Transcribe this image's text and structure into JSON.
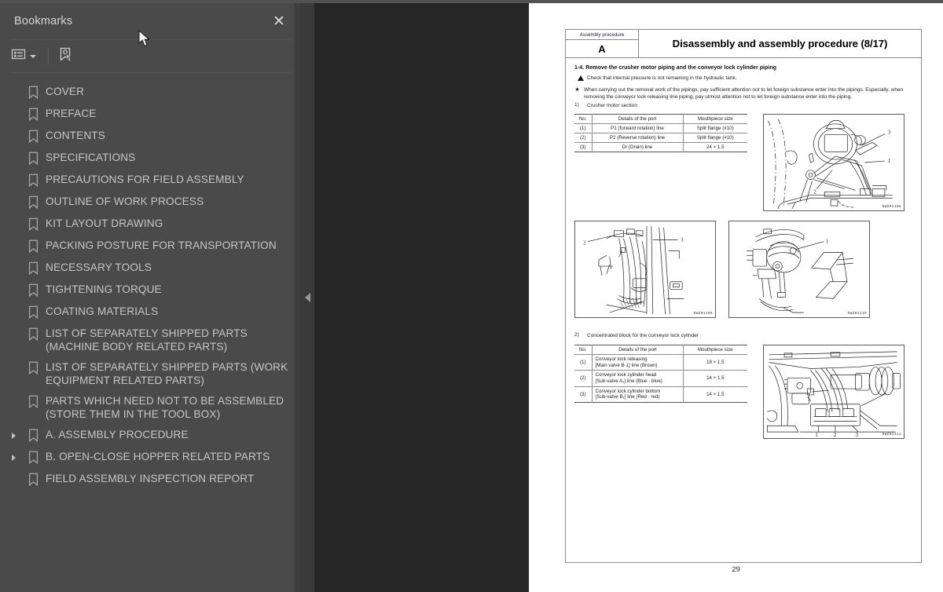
{
  "panel": {
    "title": "Bookmarks",
    "close_label": "✕",
    "toolbar": {
      "options_icon": "list-options-icon",
      "new_bookmark_icon": "new-bookmark-icon",
      "caret_icon": "chevron-down-icon"
    },
    "items": [
      {
        "label": "COVER",
        "expandable": false
      },
      {
        "label": "PREFACE",
        "expandable": false
      },
      {
        "label": "CONTENTS",
        "expandable": false
      },
      {
        "label": "SPECIFICATIONS",
        "expandable": false
      },
      {
        "label": "PRECAUTIONS FOR FIELD ASSEMBLY",
        "expandable": false
      },
      {
        "label": "OUTLINE OF WORK PROCESS",
        "expandable": false
      },
      {
        "label": "KIT LAYOUT DRAWING",
        "expandable": false
      },
      {
        "label": "PACKING POSTURE FOR TRANSPORTATION",
        "expandable": false
      },
      {
        "label": "NECESSARY TOOLS",
        "expandable": false
      },
      {
        "label": "TIGHTENING TORQUE",
        "expandable": false
      },
      {
        "label": "COATING MATERIALS",
        "expandable": false
      },
      {
        "label": "LIST OF SEPARATELY SHIPPED PARTS (MACHINE BODY RELATED PARTS)",
        "expandable": false
      },
      {
        "label": "LIST OF SEPARATELY SHIPPED PARTS (WORK EQUIPMENT RELATED PARTS)",
        "expandable": false
      },
      {
        "label": "PARTS WHICH NEED NOT TO BE ASSEMBLED (STORE THEM IN THE TOOL BOX)",
        "expandable": false
      },
      {
        "label": "A. ASSEMBLY PROCEDURE",
        "expandable": true
      },
      {
        "label": "B. OPEN-CLOSE HOPPER RELATED PARTS",
        "expandable": true
      },
      {
        "label": "FIELD ASSEMBLY INSPECTION REPORT",
        "expandable": false
      }
    ]
  },
  "viewer": {
    "collapse_icon": "collapse-left-icon",
    "page_number": "29"
  },
  "document": {
    "header": {
      "left_caption": "Assembly procedure",
      "left_code": "A",
      "title": "Disassembly and assembly procedure (8/17)"
    },
    "section_heading": "1-4.  Remove the crusher motor piping and the conveyor lock cylinder piping",
    "warning": "Check that internal pressure is not remaining in the hydraulic tank.",
    "note_bullet": "★",
    "note": "When carrying out the removal work of the pipings, pay sufficient attention not to let foreign substance enter into the pipings.  Especially, when removing the conveyor lock releasing line piping, pay utmost attention not to let foreign substance enter into the piping.",
    "subsection_1": {
      "num": "1)",
      "label": "Crusher motor section"
    },
    "subsection_2": {
      "num": "2)",
      "label": "Concentrated block for the conveyor lock cylinder"
    },
    "table1": {
      "headers": [
        "No.",
        "Details of the port",
        "Mouthpiece size"
      ],
      "rows": [
        [
          "(1)",
          "P1 (forward rotation) line",
          "Split flange (#10)"
        ],
        [
          "(2)",
          "P2 (Reverse rotation) line",
          "Split flange (#10)"
        ],
        [
          "(3)",
          "Dr (Drain) line",
          "24 × 1.5"
        ]
      ]
    },
    "table2": {
      "headers": [
        "No.",
        "Details of the port",
        "Mouthpiece size"
      ],
      "rows": [
        [
          "(1)",
          "Conveyor lock releasing\n[Main valve B-1] line (Brown)",
          "18 × 1.5"
        ],
        [
          "(2)",
          "Conveyor lock cylinder head\n[Sub-valve A₁] line (Blue · blue)",
          "14 × 1.5"
        ],
        [
          "(3)",
          "Conveyor lock cylinder bottom\n[Sub-valve B₁] line (Red · red)",
          "14 × 1.5"
        ]
      ]
    },
    "figures": [
      {
        "name": "crusher-motor-top-right",
        "code": "DWZ01108",
        "callouts": [
          "1",
          "2",
          "3"
        ]
      },
      {
        "name": "crusher-motor-mid-left",
        "code": "DWZ01109",
        "callouts": [
          "1",
          "2"
        ]
      },
      {
        "name": "crusher-motor-mid-right",
        "code": "DWZ01110",
        "callouts": [
          "1"
        ]
      },
      {
        "name": "concentrated-block-lower-right",
        "code": "DWZ01111",
        "callouts": [
          "1",
          "2",
          "3"
        ]
      }
    ]
  },
  "colors": {
    "panel_bg": "#4a4a4a",
    "viewer_bg": "#262626",
    "page_bg": "#ffffff",
    "text_muted": "#c6c6c6",
    "chrome_top": "#525252"
  }
}
